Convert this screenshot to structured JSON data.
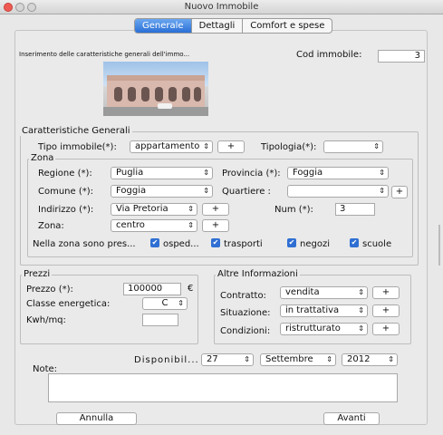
{
  "window": {
    "title": "Nuovo Immobile"
  },
  "tabs": [
    {
      "label": "Generale"
    },
    {
      "label": "Dettagli"
    },
    {
      "label": "Comfort e spese"
    }
  ],
  "header": {
    "intro": "Inserimento delle caratteristiche generali dell'immo...",
    "cod_label": "Cod immobile:",
    "cod_value": "3"
  },
  "caratteristiche": {
    "title": "Caratteristiche Generali",
    "tipo_label": "Tipo immobile(*):",
    "tipo_value": "appartamento",
    "tipologia_label": "Tipologia(*):",
    "tipologia_value": "",
    "zona": {
      "title": "Zona",
      "regione_label": "Regione (*):",
      "regione_value": "Puglia",
      "provincia_label": "Provincia (*):",
      "provincia_value": "Foggia",
      "comune_label": "Comune (*):",
      "comune_value": "Foggia",
      "quartiere_label": "Quartiere :",
      "quartiere_value": "",
      "indirizzo_label": "Indirizzo (*):",
      "indirizzo_value": "Via Pretoria",
      "num_label": "Num (*):",
      "num_value": "3",
      "zona_label": "Zona:",
      "zona_value": "centro",
      "services_label": "Nella zona sono pres...",
      "services": [
        {
          "label": "osped...",
          "checked": true
        },
        {
          "label": "trasporti",
          "checked": true
        },
        {
          "label": "negozi",
          "checked": true
        },
        {
          "label": "scuole",
          "checked": true
        }
      ]
    }
  },
  "prezzi": {
    "title": "Prezzi",
    "prezzo_label": "Prezzo (*):",
    "prezzo_value": "100000",
    "currency": "€",
    "classe_label": "Classe energetica:",
    "classe_value": "C",
    "kwh_label": "Kwh/mq:",
    "kwh_value": ""
  },
  "altre": {
    "title": "Altre Informazioni",
    "contratto_label": "Contratto:",
    "contratto_value": "vendita",
    "situazione_label": "Situazione:",
    "situazione_value": "in trattativa",
    "condizioni_label": "Condizioni:",
    "condizioni_value": "ristrutturato"
  },
  "disponibilita": {
    "label": "Disponibil...",
    "day": "27",
    "month": "Settembre",
    "year": "2012"
  },
  "note": {
    "label": "Note:",
    "value": ""
  },
  "footer": {
    "annulla": "Annulla",
    "avanti": "Avanti"
  },
  "common": {
    "plus": "+",
    "arrow": "⇕",
    "check": "✔"
  },
  "colors": {
    "accent": "#2a6fd6",
    "close": "#ee5a52",
    "minimize": "#cfcfcf",
    "zoom": "#cfcfcf"
  }
}
